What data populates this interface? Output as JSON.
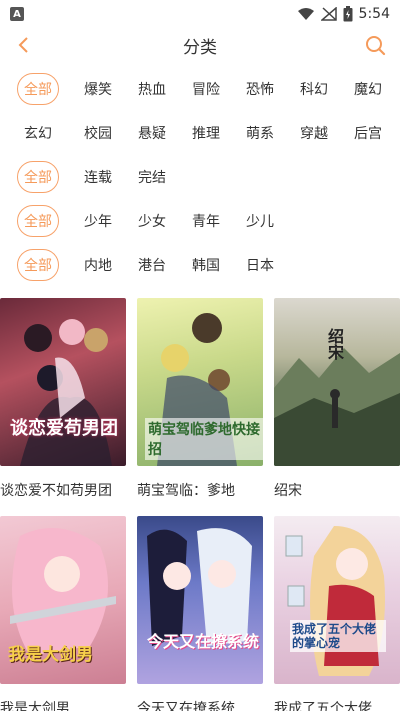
{
  "status_bar": {
    "time": "5:54",
    "app_icon_letter": "A"
  },
  "header": {
    "title": "分类"
  },
  "filters": {
    "genre": [
      "全部",
      "爆笑",
      "热血",
      "冒险",
      "恐怖",
      "科幻",
      "魔幻",
      "玄幻",
      "校园",
      "悬疑",
      "推理",
      "萌系",
      "穿越",
      "后宫"
    ],
    "status": [
      "全部",
      "连载",
      "完结"
    ],
    "audience": [
      "全部",
      "少年",
      "少女",
      "青年",
      "少儿"
    ],
    "region": [
      "全部",
      "内地",
      "港台",
      "韩国",
      "日本"
    ]
  },
  "comics": [
    {
      "title": "谈恋爱不如苟男团",
      "cover_text": "谈恋爱苟男团"
    },
    {
      "title": "萌宝驾临：爹地",
      "cover_text": "萌宝驾临爹地快接招"
    },
    {
      "title": "绍宋",
      "cover_text": "绍宋"
    },
    {
      "title": "我是大剑男",
      "cover_text": "我是大剑男"
    },
    {
      "title": "今天又在撩系统",
      "cover_text": "今天又在撩系统"
    },
    {
      "title": "我成了五个大佬",
      "cover_text": "我成了五个大佬的掌心宠"
    }
  ],
  "colors": {
    "accent": "#f59a5a",
    "text": "#333333"
  }
}
